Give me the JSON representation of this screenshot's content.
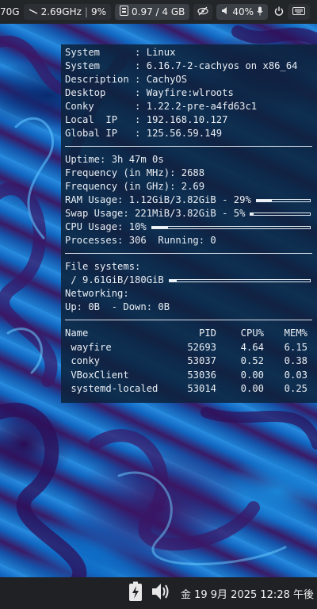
{
  "topbar": {
    "disk_value": "70G",
    "cpu_freq": "2.69GHz",
    "cpu_usage": "9%",
    "memory": "0.97 / 4 GB",
    "volume": "40%"
  },
  "conky": {
    "info": [
      {
        "label": "System     ",
        "value": "Linux"
      },
      {
        "label": "System     ",
        "value": "6.16.7-2-cachyos on x86_64"
      },
      {
        "label": "Description",
        "value": "CachyOS"
      },
      {
        "label": "Desktop    ",
        "value": "Wayfire:wlroots"
      },
      {
        "label": "Conky      ",
        "value": "1.22.2-pre-a4fd63c1"
      },
      {
        "label": "Local  IP  ",
        "value": "192.168.10.127"
      },
      {
        "label": "Global IP  ",
        "value": "125.56.59.149"
      }
    ],
    "uptime": "Uptime: 3h 47m 0s",
    "freq_mhz": "Frequency (in MHz): 2688",
    "freq_ghz": "Frequency (in GHz): 2.69",
    "ram": {
      "text": "RAM Usage: 1.12GiB/3.82GiB - 29%",
      "percent": 29
    },
    "swap": {
      "text": "Swap Usage: 221MiB/3.82GiB - 5%",
      "percent": 5
    },
    "cpu": {
      "text": "CPU Usage: 10%",
      "percent": 10
    },
    "processes": "Processes: 306  Running: 0",
    "filesystems_label": "File systems:",
    "root_fs": {
      "text": " / 9.61GiB/180GiB",
      "percent": 5
    },
    "networking_label": "Networking:",
    "network": "Up: 0B  - Down: 0B",
    "proc_headers": {
      "name": "Name",
      "pid": "PID",
      "cpu": "CPU%",
      "mem": "MEM%"
    },
    "processes_list": [
      {
        "name": " wayfire",
        "pid": "52693",
        "cpu": "4.64",
        "mem": "6.15"
      },
      {
        "name": " conky",
        "pid": "53037",
        "cpu": "0.52",
        "mem": "0.38"
      },
      {
        "name": " VBoxClient",
        "pid": "53036",
        "cpu": "0.00",
        "mem": "0.03"
      },
      {
        "name": " systemd-localed",
        "pid": "53014",
        "cpu": "0.00",
        "mem": "0.25"
      }
    ]
  },
  "bottombar": {
    "clock": "金 19  9月 2025 12:28 午後"
  },
  "colors": {
    "conky_bg": "#0c233e",
    "bar_bg": "#232629"
  },
  "icons": [
    "cpu-freq-icon",
    "memory-icon",
    "eye-slash-icon",
    "speaker-icon",
    "microphone-icon",
    "power-icon",
    "keyboard-icon",
    "battery-charging-icon",
    "volume-icon"
  ]
}
